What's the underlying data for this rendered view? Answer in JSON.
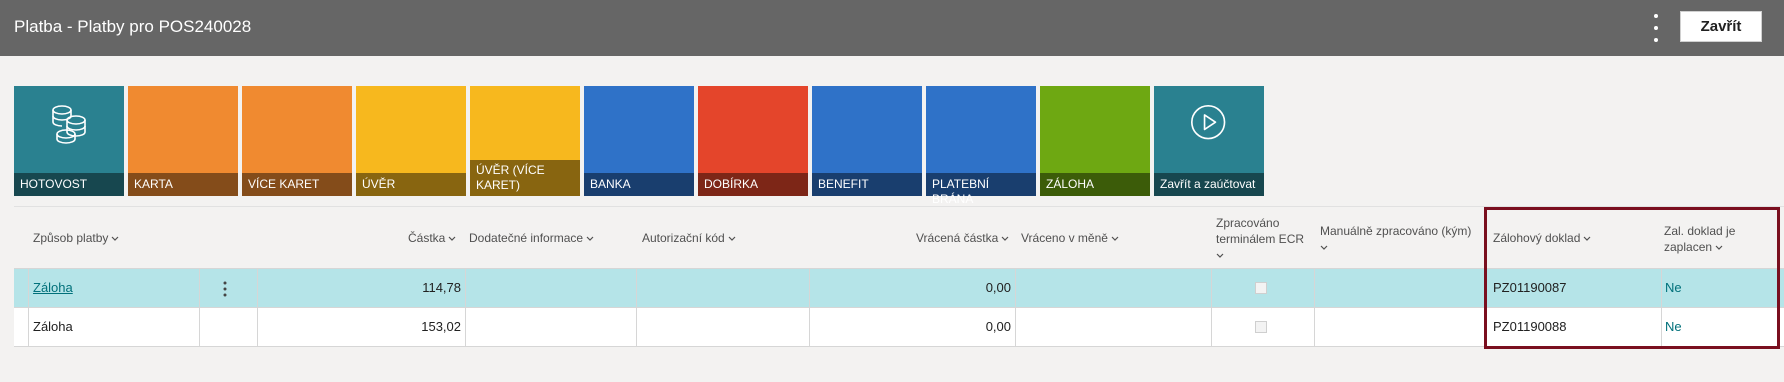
{
  "window": {
    "title": "Platba - Platby pro POS240028",
    "close_label": "Zavřít",
    "more_icon": "more-vertical-icon"
  },
  "tiles": [
    {
      "label": "HOTOVOST",
      "color": "#2a8190",
      "icon": "coins-icon"
    },
    {
      "label": "KARTA",
      "color": "#f08a30"
    },
    {
      "label": "VÍCE KARET",
      "color": "#f08a30"
    },
    {
      "label": "ÚVĚR",
      "color": "#f7b81e"
    },
    {
      "label": "ÚVĚR (VÍCE KARET)",
      "color": "#f7b81e"
    },
    {
      "label": "BANKA",
      "color": "#2f72c8"
    },
    {
      "label": "DOBÍRKA",
      "color": "#e4452b"
    },
    {
      "label": "BENEFIT",
      "color": "#2f72c8"
    },
    {
      "label": "PLATEBNÍ BRÁNA",
      "color": "#2f72c8"
    },
    {
      "label": "ZÁLOHA",
      "color": "#6ea812"
    },
    {
      "label": "Zavřít a zaúčtovat",
      "color": "#2a8190",
      "icon": "play-circle-icon"
    }
  ],
  "columns": {
    "zpusob": "Způsob platby",
    "castka": "Částka",
    "dodatecne": "Dodatečné informace",
    "autorizacni": "Autorizační kód",
    "vracena": "Vrácená částka",
    "vraceno_mena": "Vráceno v měně",
    "zpracovano_1": "Zpracováno",
    "zpracovano_2": "terminálem ECR",
    "manualne": "Manuálně zpracováno (kým)",
    "zalohovy": "Zálohový doklad",
    "zal_doklad_1": "Zal. doklad je",
    "zal_doklad_2": "zaplacen"
  },
  "rows": [
    {
      "zpusob": "Záloha",
      "castka": "114,78",
      "vracena": "0,00",
      "zalohovy": "PZ01190087",
      "zaplacen": "Ne"
    },
    {
      "zpusob": "Záloha",
      "castka": "153,02",
      "vracena": "0,00",
      "zalohovy": "PZ01190088",
      "zaplacen": "Ne"
    }
  ],
  "colors": {
    "titlebar": "#666666",
    "selected_row": "#b5e4e8",
    "highlight_border": "#7a0f1f",
    "link": "#00707a"
  }
}
